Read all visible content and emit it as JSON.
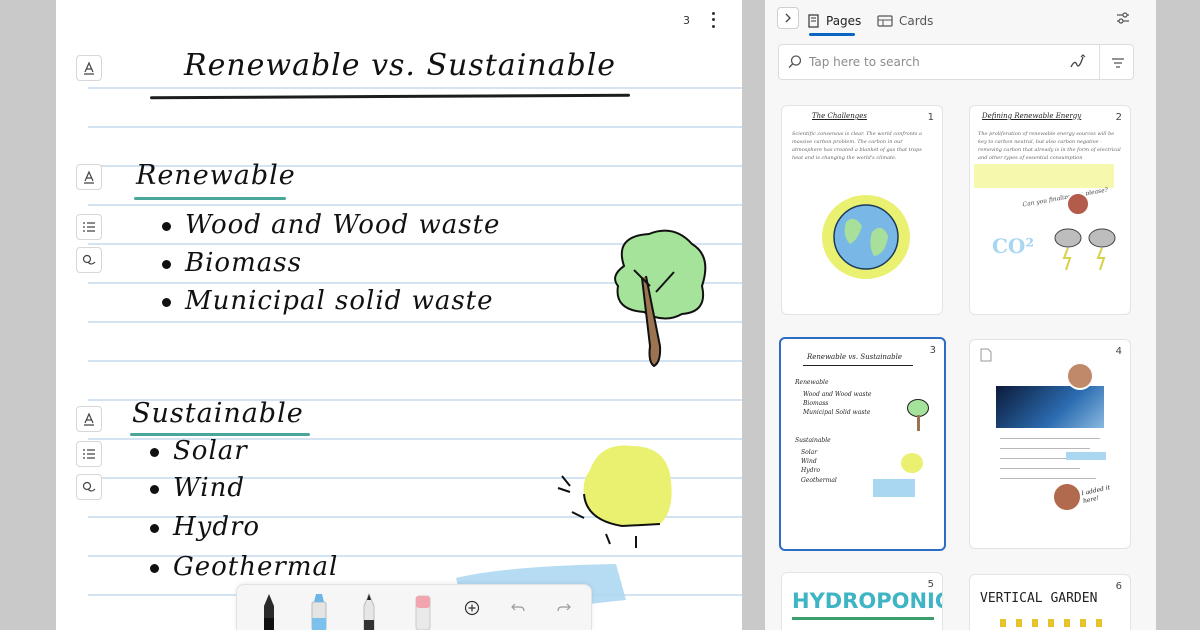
{
  "notebook": {
    "page_number": "3",
    "title": "Renewable vs. Sustainable",
    "sections": [
      {
        "heading": "Renewable",
        "items": [
          "Wood and Wood waste",
          "Biomass",
          "Municipal solid waste"
        ]
      },
      {
        "heading": "Sustainable",
        "items": [
          "Solar",
          "Wind",
          "Hydro",
          "Geothermal"
        ]
      }
    ],
    "colors": {
      "underline_accent": "#48a79a",
      "tree_leaves": "#a6e39a",
      "tree_trunk": "#9b7350",
      "sun": "#eaf171",
      "water": "#a9d6f1"
    }
  },
  "pen_toolbar": {
    "tools": [
      "pen-black",
      "highlighter-blue",
      "pencil",
      "eraser"
    ],
    "buttons": [
      "add",
      "undo",
      "redo"
    ]
  },
  "pane": {
    "tabs": [
      {
        "label": "Pages",
        "icon": "pages-icon",
        "active": true
      },
      {
        "label": "Cards",
        "icon": "cards-icon",
        "active": false
      }
    ],
    "search": {
      "placeholder": "Tap here to search"
    },
    "thumbnails": [
      {
        "number": "1",
        "title": "The Challenges",
        "body": "Scientific consensus is clear. The world confronts a massive carbon problem. The carbon in our atmosphere has created a blanket of gas that traps heat and is changing the world's climate."
      },
      {
        "number": "2",
        "title": "Defining Renewable Energy",
        "body": "The proliferation of renewable energy sources will be key to carbon neutral, but also carbon negative - removing carbon that already is in the form of electrical and other types of essential consumption",
        "note": "Can you finalize this please?",
        "co2": "CO²"
      },
      {
        "number": "3",
        "title": "Renewable vs. Sustainable",
        "headings": [
          "Renewable",
          "Sustainable"
        ],
        "items_a": [
          "Wood and Wood waste",
          "Biomass",
          "Municipal Solid waste"
        ],
        "items_b": [
          "Solar",
          "Wind",
          "Hydro",
          "Geothermal"
        ],
        "selected": true
      },
      {
        "number": "4",
        "title": "",
        "note": "I added it here!"
      },
      {
        "number": "5",
        "big_title": "HYDROPONICS"
      },
      {
        "number": "6",
        "big_title": "VERTICAL GARDEN"
      }
    ]
  },
  "accent_color": "#0a64c2"
}
